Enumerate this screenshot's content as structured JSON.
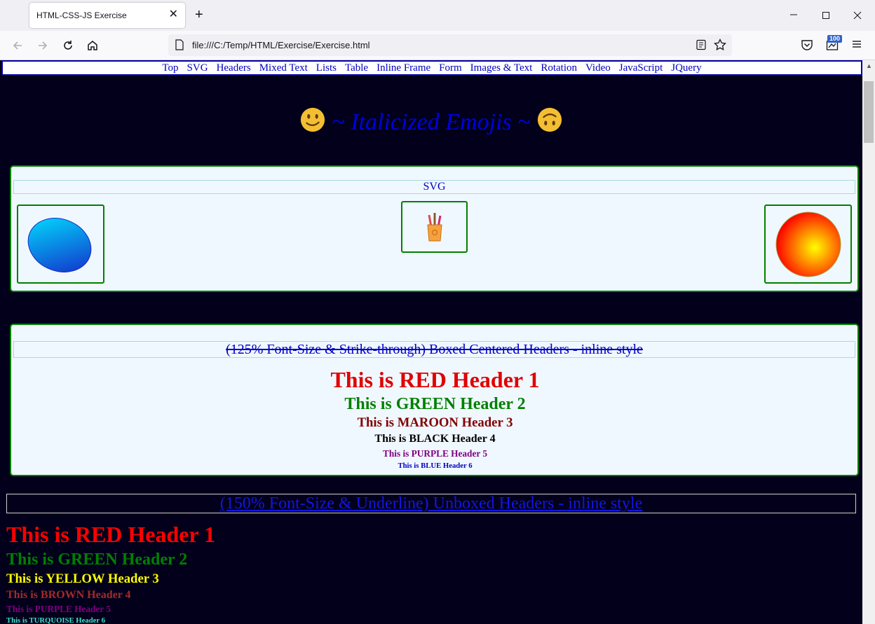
{
  "browser": {
    "tab_title": "HTML-CSS-JS Exercise",
    "url": "file:///C:/Temp/HTML/Exercise/Exercise.html",
    "extension_badge": "100"
  },
  "topnav": [
    "Top",
    "SVG",
    "Headers",
    "Mixed Text",
    "Lists",
    "Table",
    "Inline Frame",
    "Form",
    "Images & Text",
    "Rotation",
    "Video",
    "JavaScript",
    "JQuery"
  ],
  "page_title": "~ Italicized Emojis ~",
  "svg_section": {
    "header": "SVG",
    "shapes": [
      "blue-gradient-ellipse",
      "pencil-cup-icon",
      "red-yellow-radial-circle"
    ]
  },
  "boxed_headers": {
    "title": "(125% Font-Size & Strike-through) Boxed Centered Headers - inline style",
    "items": [
      {
        "text": "This is RED Header 1",
        "color": "#e00000"
      },
      {
        "text": "This is GREEN Header 2",
        "color": "#008000"
      },
      {
        "text": "This is MAROON Header 3",
        "color": "#800000"
      },
      {
        "text": "This is BLACK Header 4",
        "color": "#000000"
      },
      {
        "text": "This is PURPLE Header 5",
        "color": "#800080"
      },
      {
        "text": "This is BLUE Header 6",
        "color": "#0000c0"
      }
    ]
  },
  "unboxed_headers": {
    "title": "(150% Font-Size & Underline) Unboxed Headers - inline style",
    "items": [
      {
        "text": "This is RED Header 1",
        "color": "#ff0000"
      },
      {
        "text": "This is GREEN Header 2",
        "color": "#008000"
      },
      {
        "text": "This is YELLOW Header 3",
        "color": "#ffff00"
      },
      {
        "text": "This is BROWN Header 4",
        "color": "#a52a2a"
      },
      {
        "text": "This is PURPLE Header 5",
        "color": "#800080"
      },
      {
        "text": "This is TURQUOISE Header 6",
        "color": "#40e0d0"
      }
    ]
  }
}
